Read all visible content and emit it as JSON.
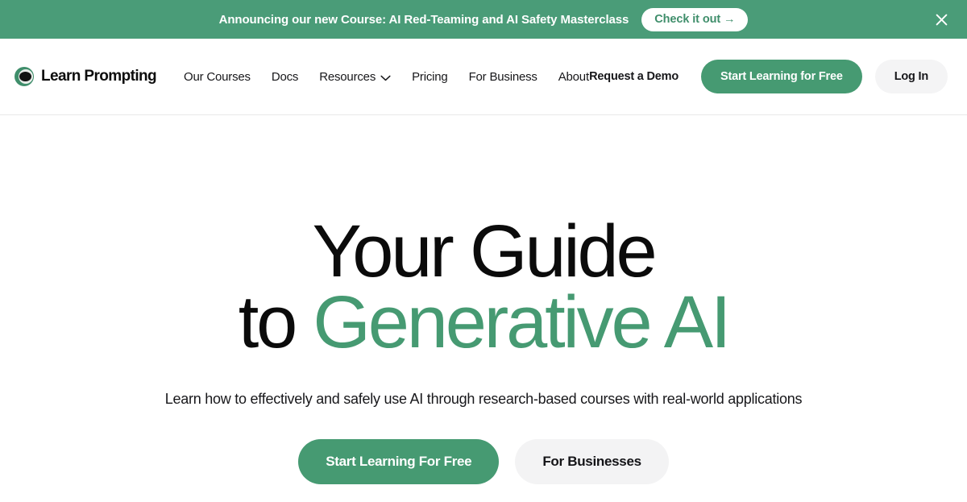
{
  "banner": {
    "message": "Announcing our new Course: AI Red-Teaming and AI Safety Masterclass",
    "cta_label": "Check it out →",
    "close_icon": "close-icon",
    "background_color": "#4a9c78",
    "text_color": "#ffffff",
    "cta_text_color": "#3f8e6b"
  },
  "header": {
    "brand": {
      "name": "Learn Prompting",
      "logo_icon": "learn-prompting-logo-icon"
    },
    "nav": [
      {
        "label": "Our Courses",
        "has_dropdown": false
      },
      {
        "label": "Docs",
        "has_dropdown": false
      },
      {
        "label": "Resources",
        "has_dropdown": true,
        "dropdown_icon": "chevron-down-icon"
      },
      {
        "label": "Pricing",
        "has_dropdown": false
      },
      {
        "label": "For Business",
        "has_dropdown": false
      },
      {
        "label": "About",
        "has_dropdown": false
      }
    ],
    "demo_label": "Request a Demo",
    "primary_cta_label": "Start Learning for Free",
    "login_label": "Log In"
  },
  "hero": {
    "title_line1": "Your Guide",
    "title_line2_plain": "to ",
    "title_line2_accent": "Generative AI",
    "subtitle": "Learn how to effectively and safely use AI through research-based courses with real-world applications",
    "primary_cta_label": "Start Learning For Free",
    "secondary_cta_label": "For Businesses",
    "accent_color": "#469a72",
    "title_color": "#0b0b0b"
  }
}
